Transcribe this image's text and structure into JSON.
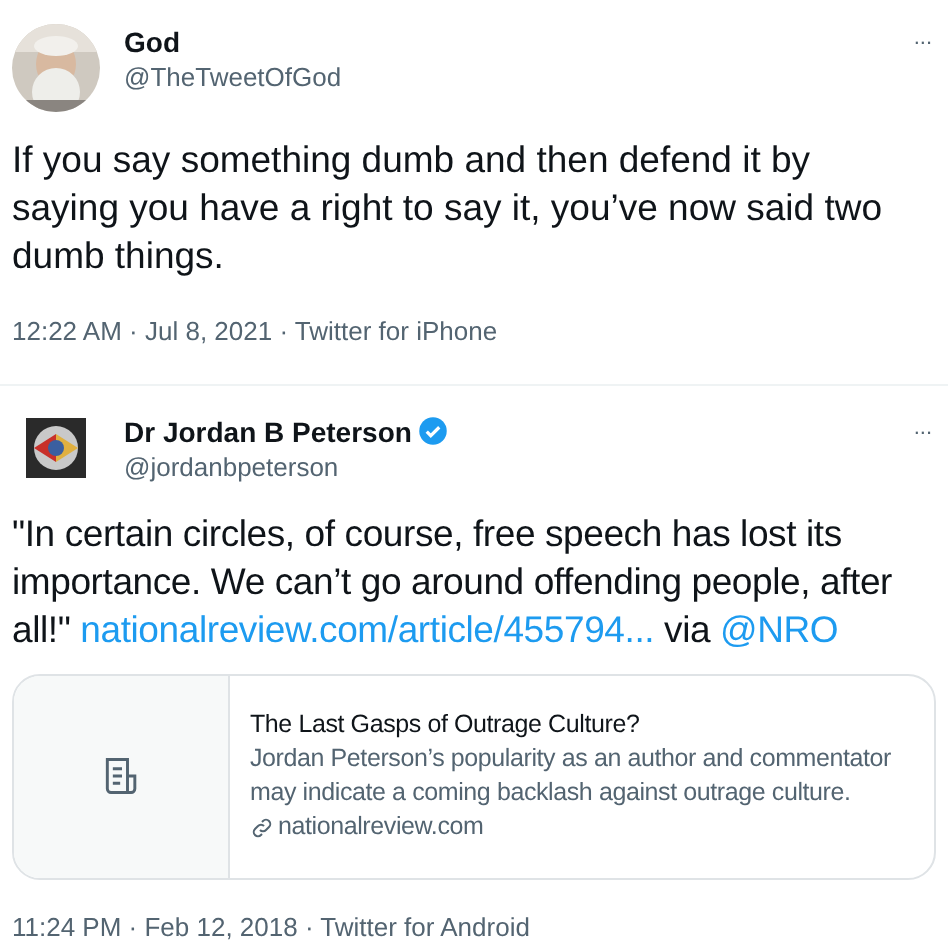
{
  "tweets": [
    {
      "author": {
        "name": "God",
        "handle": "@TheTweetOfGod",
        "verified": false
      },
      "more": "...",
      "body": [
        {
          "kind": "text",
          "text": "If you say something dumb and then defend it by saying you have a right to say it, you’ve now said two dumb things."
        }
      ],
      "meta": "12:22 AM · Jul 8, 2021 · Twitter for iPhone"
    },
    {
      "author": {
        "name": "Dr Jordan B Peterson",
        "handle": "@jordanbpeterson",
        "verified": true,
        "avatar": {
          "kind": "logo"
        }
      },
      "more": "...",
      "body": [
        {
          "kind": "text",
          "text": "\"In certain circles, of course, free speech has lost its importance. We can’t go around offending people, after all!\" "
        },
        {
          "kind": "link",
          "text": "nationalreview.com/article/455794..."
        },
        {
          "kind": "text",
          "text": " via "
        },
        {
          "kind": "link",
          "text": "@NRO"
        }
      ],
      "card": {
        "title": "The Last Gasps of Outrage Culture?",
        "description": "Jordan Peterson’s popularity as an author and commentator may indicate a coming backlash against outrage culture.",
        "domain": "nationalreview.com"
      },
      "meta": "11:24 PM · Feb 12, 2018 · Twitter for Android"
    }
  ]
}
